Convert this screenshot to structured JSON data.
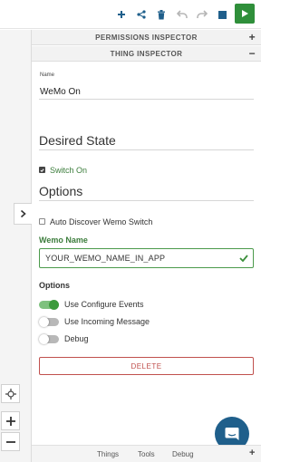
{
  "toolbar": {
    "icons": [
      "plus-icon",
      "share-icon",
      "trash-icon",
      "undo-icon",
      "redo-icon",
      "stop-icon",
      "play-icon"
    ],
    "play_color": "#2f8f3a",
    "accent_color": "#1f5f8b"
  },
  "sections": {
    "permissions": {
      "title": "PERMISSIONS INSPECTOR",
      "toggle": "+"
    },
    "thing": {
      "title": "THING INSPECTOR",
      "toggle": "−"
    }
  },
  "form": {
    "name_label": "Name",
    "name_value": "WeMo On",
    "desired_state_heading": "Desired State",
    "switch_on_label": "Switch On",
    "switch_on_checked": true,
    "options_heading": "Options",
    "auto_discover_label": "Auto Discover Wemo Switch",
    "auto_discover_checked": false,
    "wemo_name_label": "Wemo Name",
    "wemo_name_value": "YOUR_WEMO_NAME_IN_APP",
    "options_subtitle": "Options",
    "toggles": [
      {
        "label": "Use Configure Events",
        "on": true
      },
      {
        "label": "Use Incoming Message",
        "on": false
      },
      {
        "label": "Debug",
        "on": false
      }
    ],
    "delete_label": "DELETE"
  },
  "canvas": {
    "controls": [
      "crosshair-icon",
      "zoom-in-icon",
      "zoom-out-icon"
    ]
  },
  "bottom_tabs": [
    "Things",
    "Tools",
    "Debug"
  ],
  "bottom_toggle": "+"
}
